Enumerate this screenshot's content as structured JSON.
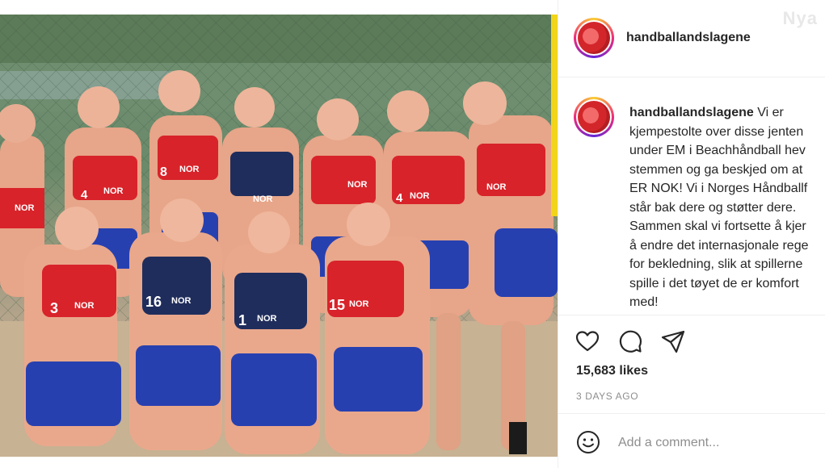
{
  "post": {
    "username": "handballandslagene",
    "caption_lines": [
      "Vi er",
      "kjempestolte over disse jenten",
      "under EM i Beachhåndball hev",
      "stemmen og ga beskjed om at",
      "ER NOK! Vi i Norges Håndballf",
      "står bak dere og støtter dere.",
      "Sammen skal vi fortsette å kjer",
      "å endre det internasjonale rege",
      "for bekledning, slik at spillerne",
      "spille i det tøyet de er komfort",
      "med!"
    ],
    "likes": "15,683 likes",
    "time_ago": "3 DAYS AGO",
    "comment_placeholder": "Add a comment..."
  },
  "watermark": "Nya",
  "photo": {
    "jersey_text": "NOR",
    "jersey_numbers": [
      "4",
      "8",
      "3",
      "16",
      "1",
      "15",
      "4"
    ]
  },
  "icons": {
    "like": "heart-icon",
    "comment": "comment-bubble-icon",
    "share": "paper-plane-icon",
    "emoji": "smiley-icon"
  },
  "colors": {
    "jersey_red": "#d8232a",
    "jersey_navy": "#1f2d5c",
    "shorts_blue": "#2740b0",
    "accent_yellow": "#f2d51a"
  }
}
